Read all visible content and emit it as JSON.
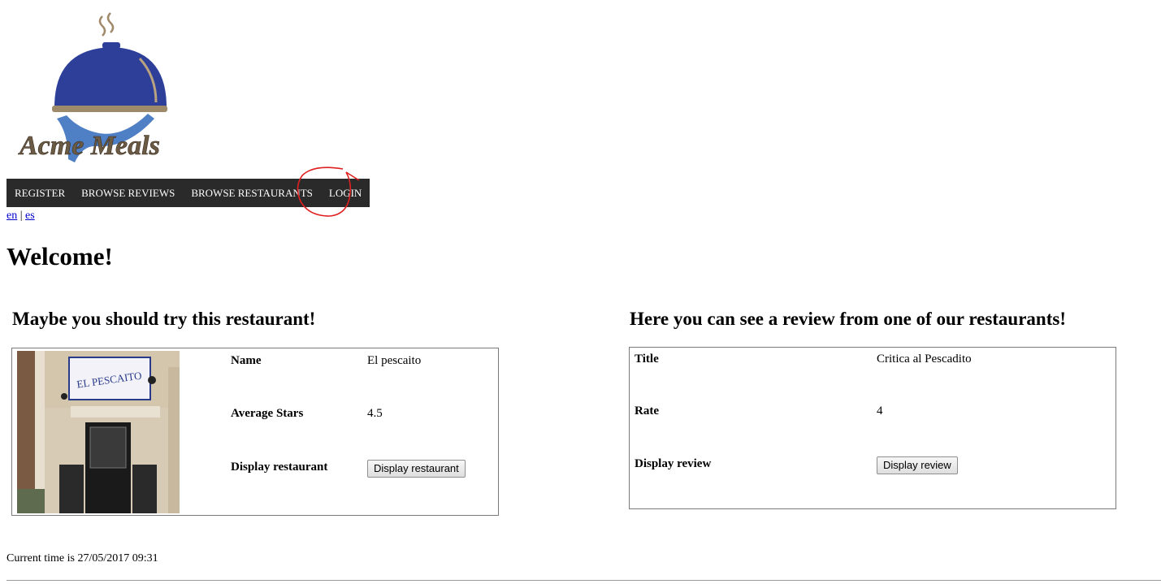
{
  "logo": {
    "brand_text": "Acme Meals"
  },
  "nav": {
    "items": [
      {
        "label": "REGISTER"
      },
      {
        "label": "BROWSE REVIEWS"
      },
      {
        "label": "BROWSE RESTAURANTS"
      },
      {
        "label": "LOGIN"
      }
    ]
  },
  "language": {
    "en": "en",
    "separator": "|",
    "es": "es"
  },
  "page": {
    "title": "Welcome!"
  },
  "restaurant_section": {
    "heading": "Maybe you should try this restaurant!",
    "photo_sign_text": "EL PESCAITO",
    "rows": [
      {
        "label": "Name",
        "value": "El pescaito"
      },
      {
        "label": "Average Stars",
        "value": "4.5"
      },
      {
        "label": "Display restaurant",
        "button": "Display restaurant"
      }
    ]
  },
  "review_section": {
    "heading": "Here you can see a review from one of our restaurants!",
    "rows": [
      {
        "label": "Title",
        "value": "Critica al Pescadito"
      },
      {
        "label": "Rate",
        "value": "4"
      },
      {
        "label": "Display review",
        "button": "Display review"
      }
    ]
  },
  "footer": {
    "current_time": "Current time is 27/05/2017 09:31"
  },
  "colors": {
    "nav_background": "#2a2a2a",
    "logo_cloche": "#2e3f9a",
    "logo_hand": "#4f7fc4",
    "logo_text": "#6b5a44",
    "annotation": "#e02020"
  }
}
